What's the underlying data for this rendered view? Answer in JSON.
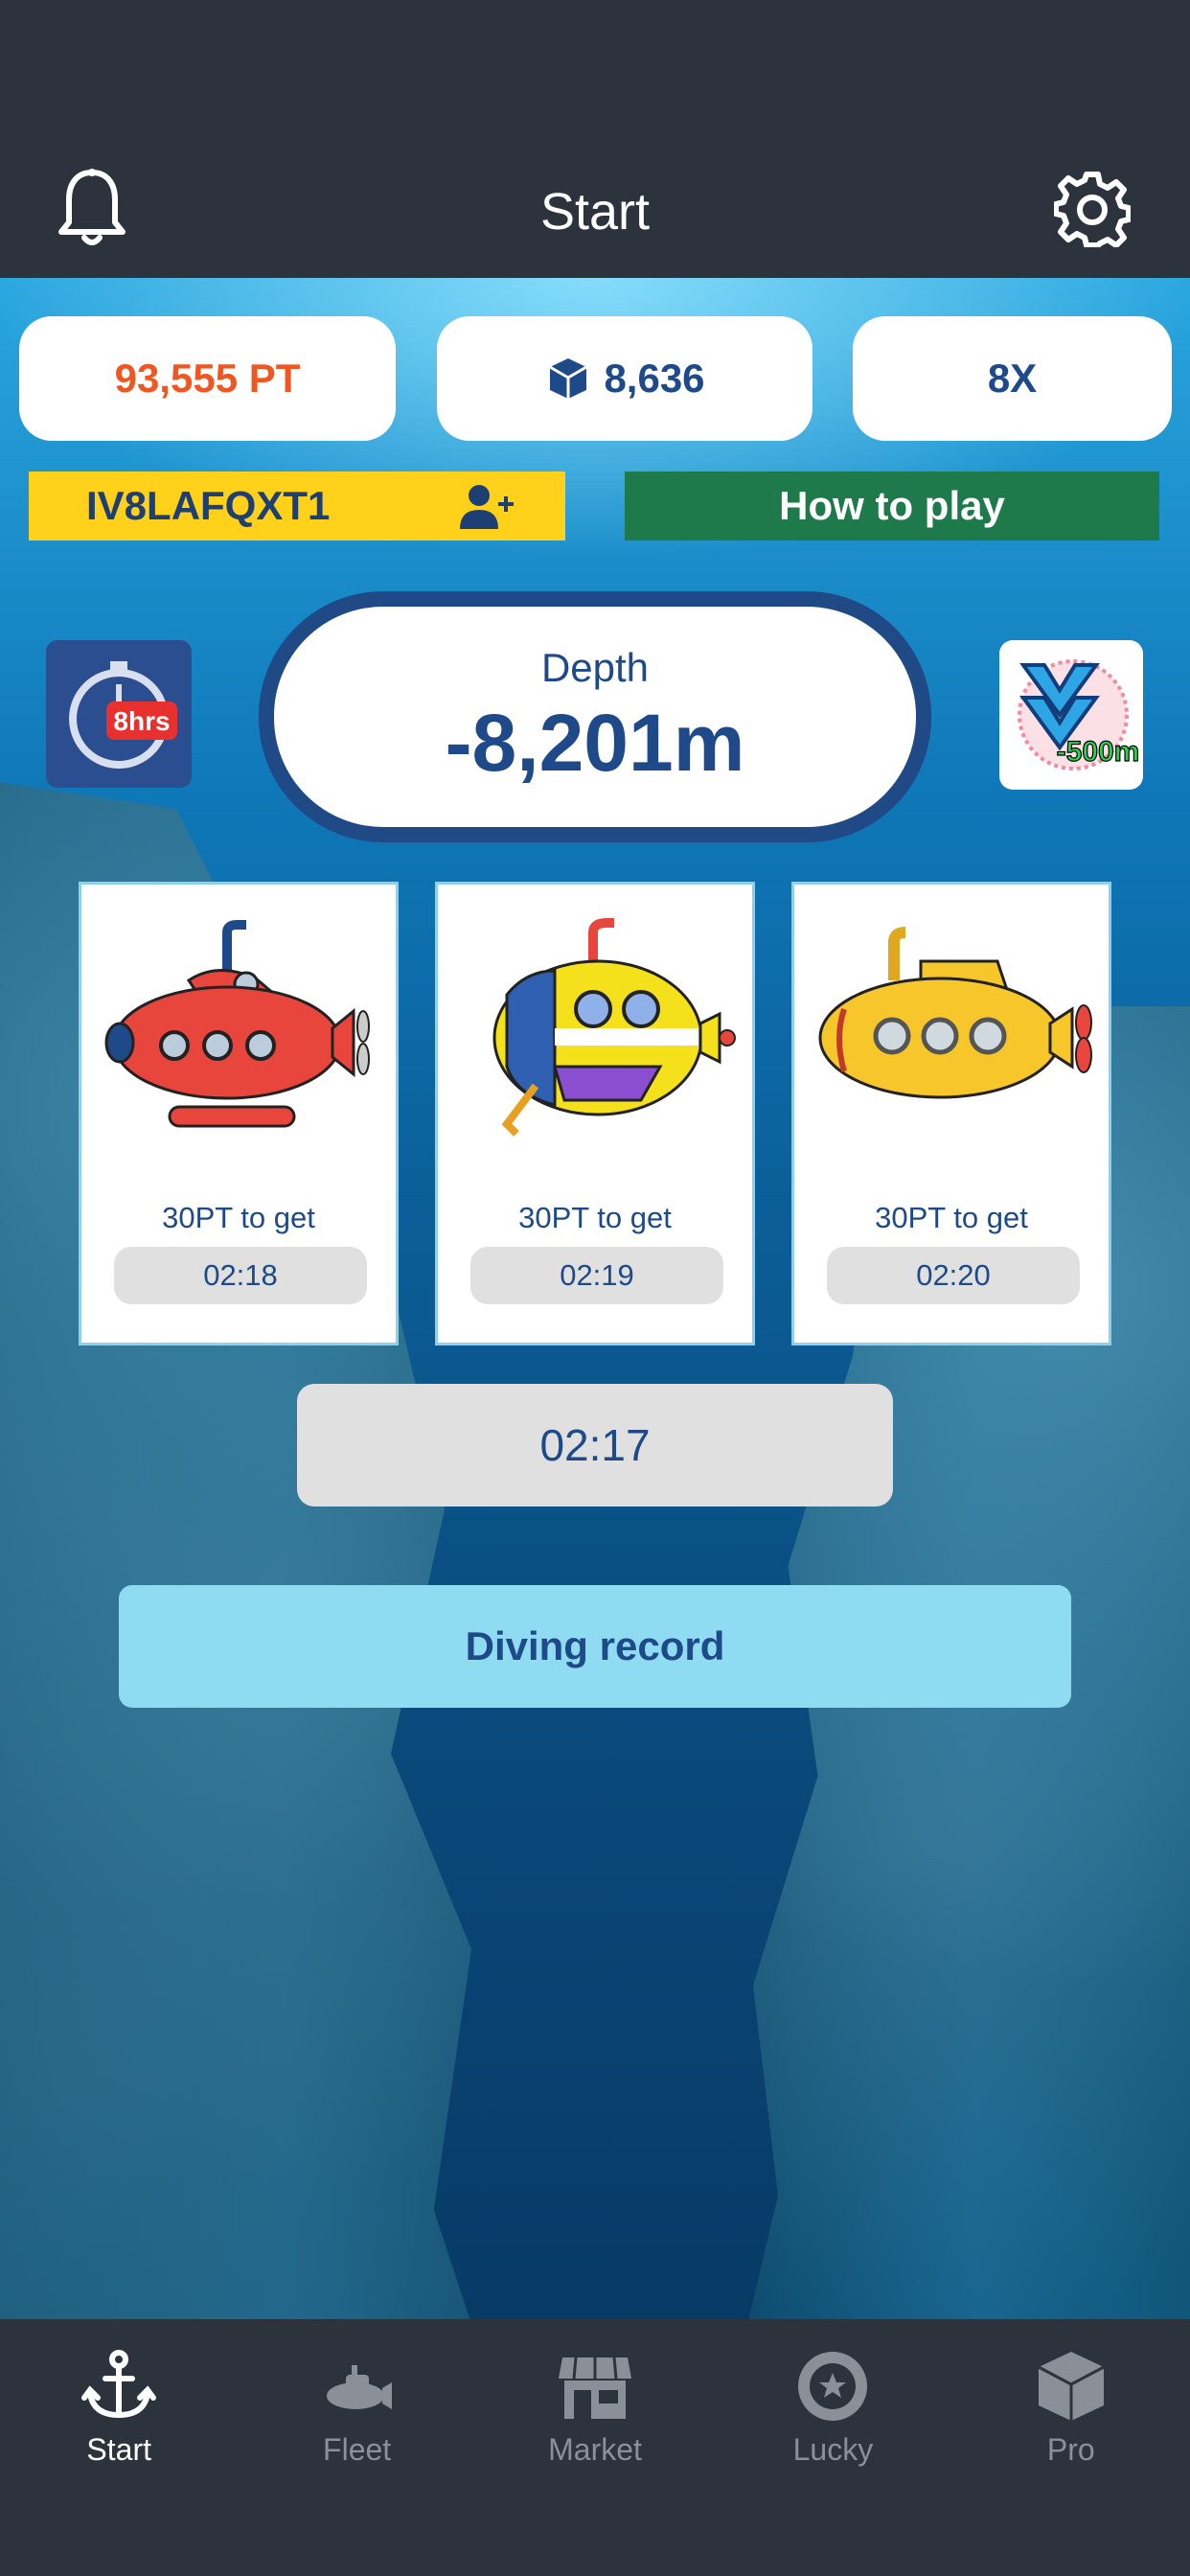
{
  "header": {
    "title": "Start"
  },
  "stats": {
    "points": "93,555 PT",
    "cubes": "8,636",
    "multiplier": "8X"
  },
  "invite": {
    "code": "IV8LAFQXT1"
  },
  "how_to_play": "How to play",
  "boost_left": {
    "icon": "stopwatch-icon",
    "text": "8hrs"
  },
  "boost_right": {
    "icon": "dive-chevron-icon",
    "text": "-500m"
  },
  "depth": {
    "label": "Depth",
    "value": "-8,201m"
  },
  "submarines": [
    {
      "text": "30PT to get",
      "timer": "02:18",
      "color": "#e8453c"
    },
    {
      "text": "30PT to get",
      "timer": "02:19",
      "color": "#f4e11c"
    },
    {
      "text": "30PT to get",
      "timer": "02:20",
      "color": "#f6c62a"
    }
  ],
  "main_timer": "02:17",
  "diving_record": "Diving record",
  "tabs": [
    {
      "label": "Start",
      "icon": "anchor-icon",
      "active": true
    },
    {
      "label": "Fleet",
      "icon": "submarine-icon",
      "active": false
    },
    {
      "label": "Market",
      "icon": "store-icon",
      "active": false
    },
    {
      "label": "Lucky",
      "icon": "wheel-icon",
      "active": false
    },
    {
      "label": "Pro",
      "icon": "cube-icon",
      "active": false
    }
  ]
}
